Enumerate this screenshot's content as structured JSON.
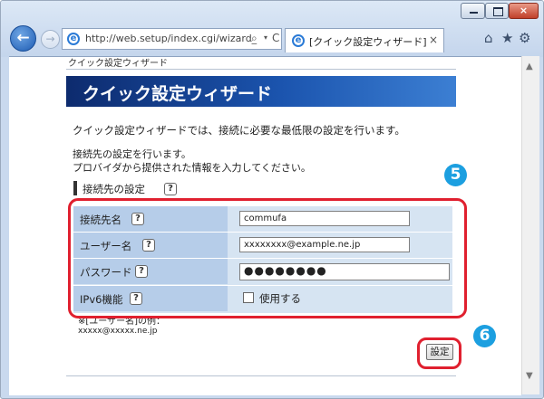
{
  "browser": {
    "back_glyph": "←",
    "forward_glyph": "→",
    "address_url": "http://web.setup/index.cgi/wizard_",
    "search_glyph": "⌕",
    "dropdown_glyph": "▾",
    "refresh_glyph": "C",
    "tab_title": "[クイック設定ウィザード]",
    "tab_close_glyph": "×",
    "home_glyph": "⌂",
    "favorites_glyph": "★",
    "tools_glyph": "⚙",
    "scroll_up_glyph": "▲",
    "scroll_down_glyph": "▼",
    "window_close_glyph": "×",
    "ie_glyph": "e"
  },
  "page": {
    "breadcrumb": "クイック設定ウィザード",
    "banner_title": "クイック設定ウィザード",
    "intro": "クイック設定ウィザードでは、接続に必要な最低限の設定を行います。",
    "info_line1": "接続先の設定を行います。",
    "info_line2": "プロバイダから提供された情報を入力してください。",
    "section_title": "接続先の設定",
    "help_glyph": "?",
    "fields": {
      "connection_name": {
        "label": "接続先名",
        "value": "commufa"
      },
      "username": {
        "label": "ユーザー名",
        "value": "xxxxxxxx@example.ne.jp"
      },
      "password": {
        "label": "パスワード",
        "value": "●●●●●●●●"
      },
      "ipv6": {
        "label": "IPv6機能",
        "checkbox_label": "使用する"
      }
    },
    "note_line1": "※[ユーザー名]の例：",
    "note_line2": "xxxxx@xxxxx.ne.jp",
    "submit_label": "設定"
  },
  "annotations": {
    "step5": "5",
    "step6": "6",
    "highlight_color": "#e0202f",
    "badge_color": "#1c9fe0"
  },
  "colors": {
    "banner_gradient_start": "#0d2b6e",
    "banner_gradient_end": "#3c7fd3",
    "label_cell": "#b6cde9",
    "input_cell": "#d6e4f2"
  }
}
